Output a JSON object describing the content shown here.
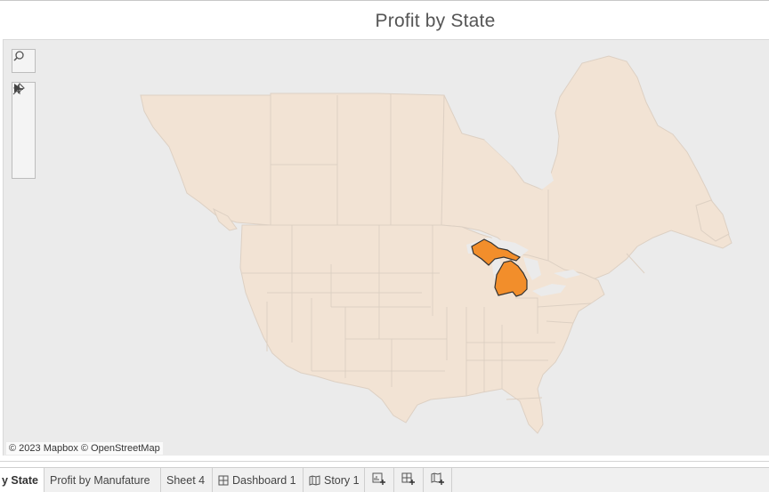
{
  "sheet": {
    "title": "Profit by State"
  },
  "map": {
    "attribution": "© 2023 Mapbox © OpenStreetMap",
    "base_land_color": "#f2e3d4",
    "water_color": "#ebebeb",
    "highlight_color": "#f28e2b",
    "highlighted_regions": [
      "Michigan"
    ],
    "toolbar_icons": [
      "search-icon",
      "zoom-in-icon",
      "zoom-out-icon",
      "pin-icon",
      "expand-arrow-icon"
    ]
  },
  "tabs": [
    {
      "label": "y State",
      "active": true
    },
    {
      "label": "Profit by Manufature",
      "active": false
    },
    {
      "label": "Sheet 4",
      "active": false
    },
    {
      "label": "Dashboard 1",
      "icon": "dashboard-icon",
      "active": false
    },
    {
      "label": "Story 1",
      "icon": "story-icon",
      "active": false
    }
  ],
  "tab_actions": [
    "new-worksheet-icon",
    "new-dashboard-icon",
    "new-story-icon"
  ]
}
